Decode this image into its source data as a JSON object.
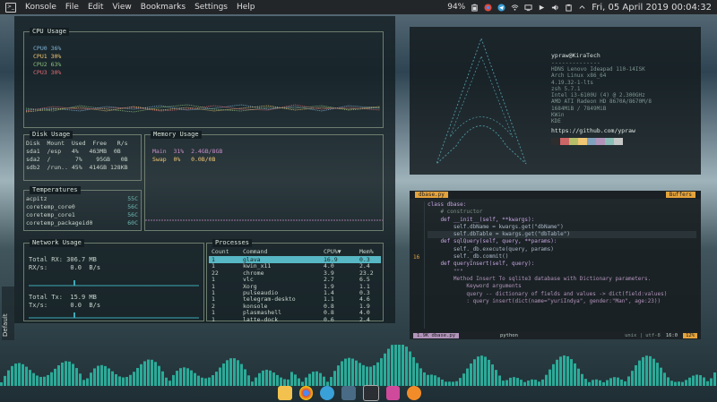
{
  "topbar": {
    "app_name": "Konsole",
    "menu": [
      "File",
      "Edit",
      "View",
      "Bookmarks",
      "Settings",
      "Help"
    ],
    "battery": "94%",
    "clock": "Fri, 05 April 2019 00:04:32"
  },
  "side_label": "Default",
  "cpu": {
    "title": "CPU Usage",
    "rows": [
      {
        "label": "CPU0",
        "value": "36%",
        "color": "#7fb3d5"
      },
      {
        "label": "CPU1",
        "value": "30%",
        "color": "#f0c674"
      },
      {
        "label": "CPU2",
        "value": "63%",
        "color": "#8fbf7f"
      },
      {
        "label": "CPU3",
        "value": "30%",
        "color": "#e06c75"
      }
    ]
  },
  "disk": {
    "title": "Disk Usage",
    "headers": [
      "Disk",
      "Mount",
      "Used",
      "Free",
      "R/s"
    ],
    "rows": [
      [
        "sda1",
        "/esp",
        "4%",
        "463MB",
        "0B"
      ],
      [
        "sda2",
        "/",
        "7%",
        "95GB",
        "0B"
      ],
      [
        "sdb2",
        "/run..",
        "45%",
        "414GB",
        "128KB"
      ]
    ]
  },
  "memory": {
    "title": "Memory Usage",
    "rows": [
      {
        "label": "Main",
        "pct": "31%",
        "value": "2.4GB/8GB"
      },
      {
        "label": "Swap",
        "pct": "0%",
        "value": "0.0B/0B"
      }
    ]
  },
  "temps": {
    "title": "Temperatures",
    "rows": [
      {
        "label": "acpitz",
        "value": "55C"
      },
      {
        "label": "coretemp_core0",
        "value": "56C"
      },
      {
        "label": "coretemp_core1",
        "value": "56C"
      },
      {
        "label": "coretemp_packageid0",
        "value": "60C"
      }
    ]
  },
  "network": {
    "title": "Network Usage",
    "total_rx": "Total RX: 306.7 MB",
    "rx_rate": "RX/s:      0.0  B/s",
    "total_tx": "Total Tx:  15.9 MB",
    "tx_rate": "Tx/s:      0.0  B/s"
  },
  "processes": {
    "title": "Processes",
    "headers": [
      "Count",
      "Command",
      "CPU%▼",
      "Mem%"
    ],
    "rows": [
      [
        "1",
        "glava",
        "16.9",
        "0.3"
      ],
      [
        "1",
        "kwin_x11",
        "4.0",
        "2.4"
      ],
      [
        "22",
        "chrome",
        "3.9",
        "23.2"
      ],
      [
        "1",
        "vlc",
        "2.7",
        "6.5"
      ],
      [
        "1",
        "Xorg",
        "1.9",
        "1.1"
      ],
      [
        "1",
        "pulseaudio",
        "1.4",
        "0.3"
      ],
      [
        "1",
        "telegram-deskto",
        "1.1",
        "4.6"
      ],
      [
        "2",
        "konsole",
        "0.8",
        "1.9"
      ],
      [
        "1",
        "plasmashell",
        "0.8",
        "4.0"
      ],
      [
        "1",
        "latte-dock",
        "0.6",
        "2.4"
      ]
    ]
  },
  "neofetch": {
    "user": "ypraw@KiraTech",
    "separator": "--------------",
    "info": [
      "HDNS Lenovo Ideapad 110-14ISK",
      "Arch Linux x86_64",
      "4.19.32-1-lts",
      "zsh 5.7.1",
      "Intel i3-6100U (4) @ 2.300GHz",
      "AMD ATI Radeon HD 8670A/8670M/8",
      "1684MiB / 7849MiB",
      "KWin",
      "KDE"
    ],
    "url": "https://github.com/ypraw",
    "swatches": [
      "#2d2d2d",
      "#cc6666",
      "#b5bd68",
      "#f0c674",
      "#81a2be",
      "#b294bb",
      "#8abeb7",
      "#c5c8c6"
    ]
  },
  "editor": {
    "tab_file": "dbase.py",
    "tab_right": "Buffers",
    "cursor_line": "16",
    "code": [
      "class dbase:",
      "",
      "    # constructor",
      "    def __init__(self, **kwargs):",
      "        self.dbName = kwargs.get(\"dbName\")",
      "        self.dbTable = kwargs.get(\"dbTable\")",
      "",
      "    def sqlQuery(self, query, **params):",
      "        self._db.execute(query, params)",
      "        self._db.commit()",
      "",
      "    def queryInsert(self, query):",
      "        \"\"\"",
      "        Method Insert To sqlite3 database with Dictionary parameters.",
      "            Keyword arguments",
      "            query -- dictionary of fields and values -> dict(field:values)",
      "            : query insert(dict(name=\"yuriIndya\", gender:\"Man\", age:23))"
    ],
    "status_left": "1.9K dbase.py",
    "status_lang": "python",
    "status_enc": "unix | utf-8",
    "status_pos": "16:0",
    "status_pct": "12%"
  }
}
